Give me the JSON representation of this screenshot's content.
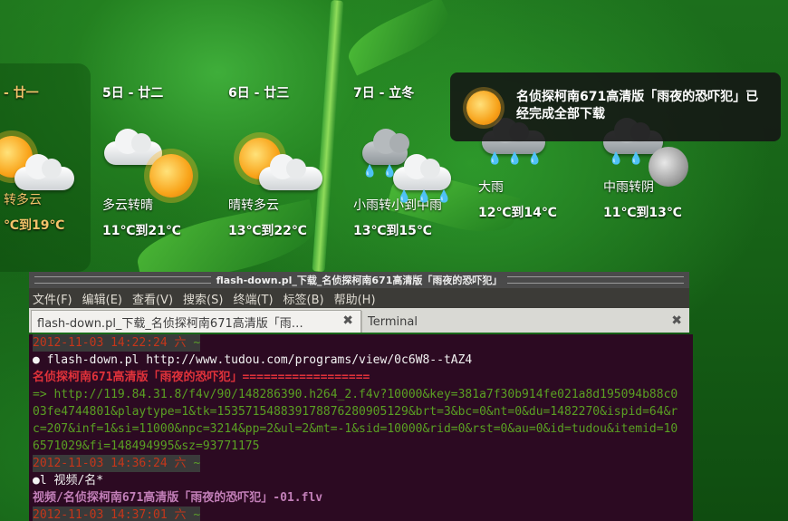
{
  "weather": {
    "days": [
      {
        "date": "- 廿一",
        "desc": "转多云",
        "temp": "℃到19℃"
      },
      {
        "date": "5日 - 廿二",
        "desc": "多云转晴",
        "temp": "11℃到21℃"
      },
      {
        "date": "6日 - 廿三",
        "desc": "晴转多云",
        "temp": "13℃到22℃"
      },
      {
        "date": "7日 - 立冬",
        "desc": "小雨转小到中雨",
        "temp": "13℃到15℃"
      },
      {
        "date": "",
        "desc": "大雨",
        "temp": "12℃到14℃"
      },
      {
        "date": "",
        "desc": "中雨转阴",
        "temp": "11℃到13℃"
      }
    ]
  },
  "notification": {
    "icon": "sun-icon",
    "text": "名侦探柯南671高清版「雨夜的恐吓犯」已经完成全部下载"
  },
  "terminal": {
    "window_title": "flash-down.pl_下载_名侦探柯南671高清版「雨夜的恐吓犯」",
    "menu": [
      "文件(F)",
      "编辑(E)",
      "查看(V)",
      "搜索(S)",
      "终端(T)",
      "标签(B)",
      "帮助(H)"
    ],
    "tabs": [
      {
        "label": "flash-down.pl_下载_名侦探柯南671高清版「雨…",
        "active": true
      },
      {
        "label": "Terminal",
        "active": false
      }
    ],
    "lines": {
      "ts1": "2012-11-03 14:22:24 六",
      "tilde": "~",
      "cmd1": "● flash-down.pl http://www.tudou.com/programs/view/0c6W8--tAZ4",
      "title1": "名侦探柯南671高清版「雨夜的恐吓犯」==================",
      "url": "=> http://119.84.31.8/f4v/90/148286390.h264_2.f4v?10000&key=381a7f30b914fe021a8d195094b88c003fe4744801&playtype=1&tk=153571548839178876280905129&brt=3&bc=0&nt=0&du=1482270&ispid=64&rc=207&inf=1&si=11000&npc=3214&pp=2&ul=2&mt=-1&sid=10000&rid=0&rst=0&au=0&id=tudou&itemid=106571029&fi=148494995&sz=93771175",
      "ts2": "2012-11-03 14:36:24 六",
      "cmd2": "●l 视频/名*",
      "file": "视频/名侦探柯南671高清版「雨夜的恐吓犯」-01.flv",
      "ts3": "2012-11-03 14:37:01 六"
    }
  }
}
